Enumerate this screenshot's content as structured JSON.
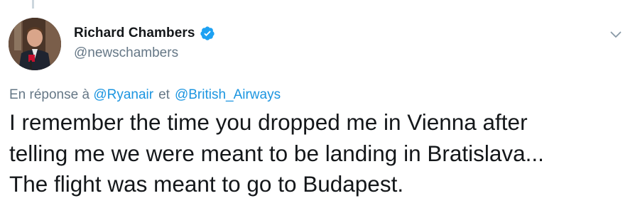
{
  "tweet": {
    "author": {
      "display_name": "Richard Chambers",
      "handle": "@newschambers",
      "verified": true,
      "avatar_icon": "profile-photo"
    },
    "menu_icon": "chevron-down-icon",
    "reply": {
      "prefix": "En réponse à",
      "mentions": [
        "@Ryanair",
        "@British_Airways"
      ],
      "separator": "et"
    },
    "text_lines": [
      "I remember the time you dropped me in Vienna after",
      "telling me we were meant to be landing in Bratislava...",
      "The flight was meant to go to Budapest."
    ]
  },
  "colors": {
    "text": "#14171a",
    "secondary": "#657786",
    "link": "#1b95e0",
    "verified": "#1da1f2",
    "thread_line": "#ccd6dd"
  }
}
